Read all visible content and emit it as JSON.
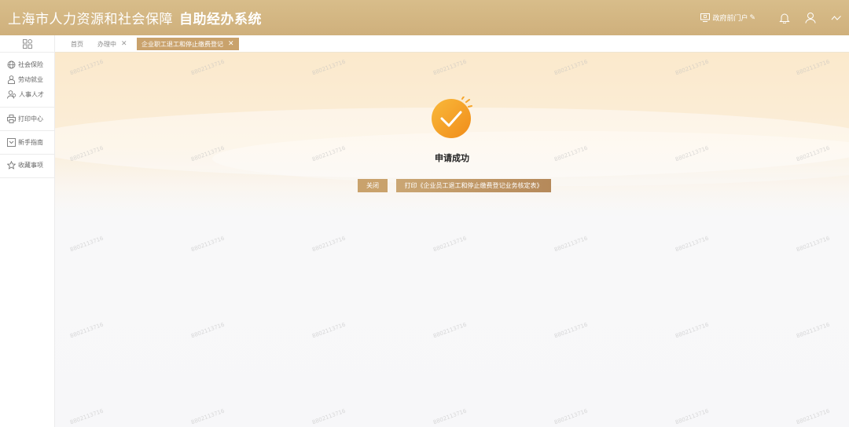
{
  "header": {
    "title": "上海市人力资源和社会保障",
    "subtitle": "自助经办系统",
    "portal_label": "政府前门户",
    "icons": [
      "monitor-icon",
      "bell-icon",
      "user-icon",
      "wave-icon"
    ]
  },
  "sidebar": {
    "items": [
      {
        "label": "社会保险",
        "icon": "globe-icon"
      },
      {
        "label": "劳动就业",
        "icon": "worker-icon"
      },
      {
        "label": "人事人才",
        "icon": "people-icon"
      },
      {
        "label": "打印中心",
        "icon": "printer-icon"
      },
      {
        "label": "新手指南",
        "icon": "guide-icon"
      },
      {
        "label": "收藏事项",
        "icon": "star-icon"
      }
    ]
  },
  "tabs": [
    {
      "label": "首页",
      "closable": false
    },
    {
      "label": "办理中",
      "closable": true
    },
    {
      "label": "企业职工退工和停止缴费登记",
      "closable": true,
      "active": true
    }
  ],
  "result": {
    "message": "申请成功",
    "close_label": "关闭",
    "print_label": "打印《企业员工退工和停止缴费登记业务核定表》"
  },
  "watermark": "8802113716",
  "colors": {
    "header_bg": "#d4b683",
    "accent": "#c9a26c",
    "success_orange": "#f5a623"
  }
}
